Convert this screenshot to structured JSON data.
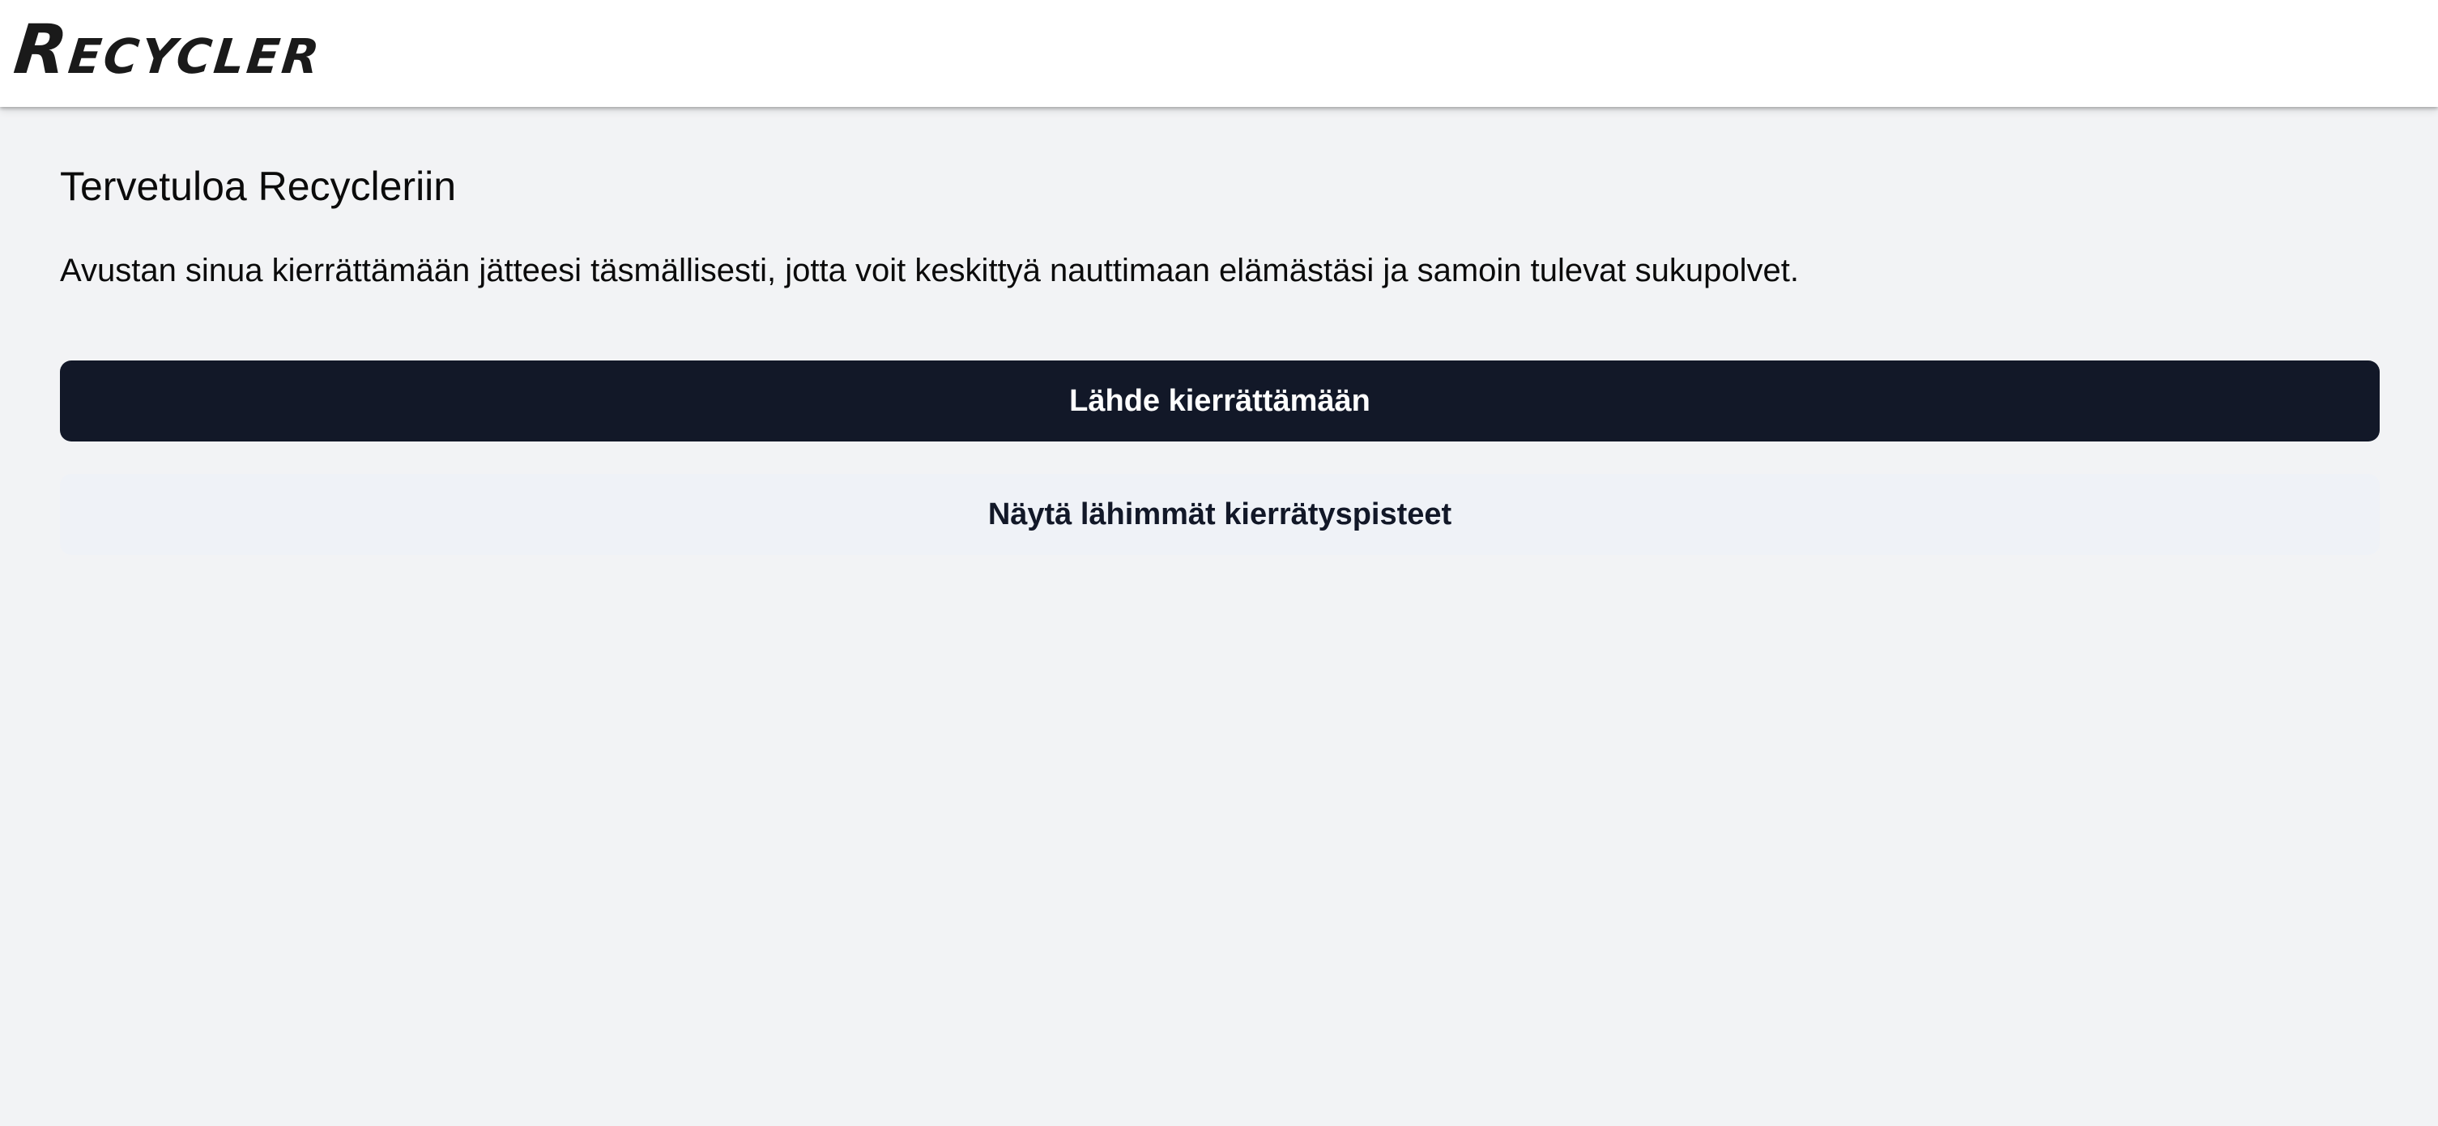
{
  "header": {
    "logo_text": "Recycler"
  },
  "main": {
    "title": "Tervetuloa Recycleriin",
    "intro": "Avustan sinua kierrättämään jätteesi täsmällisesti, jotta voit keskittyä nauttimaan elämästäsi ja samoin tulevat sukupolvet.",
    "primary_button_label": "Lähde kierrättämään",
    "secondary_button_label": "Näytä lähimmät kierrätyspisteet"
  },
  "colors": {
    "page_background": "#f2f3f5",
    "header_background": "#ffffff",
    "primary_button": "#121828",
    "secondary_button": "#eff2f7"
  }
}
